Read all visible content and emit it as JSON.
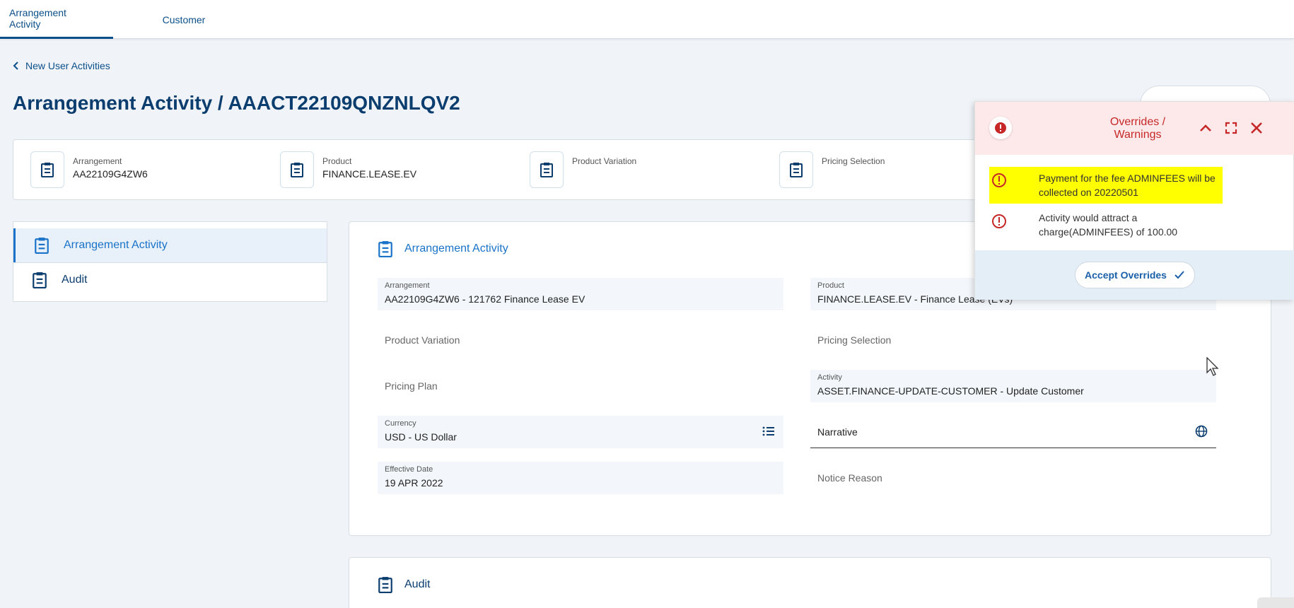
{
  "tabs": [
    {
      "label_line1": "Arrangement",
      "label_line2": "Activity"
    },
    {
      "label": "Customer"
    }
  ],
  "back_link": "New User Activities",
  "page_title": "Arrangement Activity / AAACT22109QNZNLQV2",
  "summary": [
    {
      "label": "Arrangement",
      "value": "AA22109G4ZW6"
    },
    {
      "label": "Product",
      "value": "FINANCE.LEASE.EV"
    },
    {
      "label": "Product Variation",
      "value": ""
    },
    {
      "label": "Pricing Selection",
      "value": ""
    }
  ],
  "nav": [
    {
      "label": "Arrangement Activity"
    },
    {
      "label": "Audit"
    }
  ],
  "section_title": "Arrangement Activity",
  "fields": {
    "arrangement": {
      "label": "Arrangement",
      "value": "AA22109G4ZW6 - 121762 Finance Lease EV"
    },
    "product": {
      "label": "Product",
      "value": "FINANCE.LEASE.EV - Finance Lease (EVs)"
    },
    "product_variation": {
      "placeholder": "Product Variation"
    },
    "pricing_selection": {
      "placeholder": "Pricing Selection"
    },
    "pricing_plan": {
      "placeholder": "Pricing Plan"
    },
    "activity": {
      "label": "Activity",
      "value": "ASSET.FINANCE-UPDATE-CUSTOMER - Update Customer"
    },
    "currency": {
      "label": "Currency",
      "value": "USD - US Dollar"
    },
    "narrative": {
      "placeholder": "Narrative"
    },
    "effective_date": {
      "label": "Effective Date",
      "value": "19 APR 2022"
    },
    "notice_reason": {
      "placeholder": "Notice Reason"
    }
  },
  "audit_title": "Audit",
  "overrides": {
    "title": "Overrides / Warnings",
    "messages": [
      "Payment for the fee ADMINFEES will be collected on 20220501",
      "Activity would attract a charge(ADMINFEES) of 100.00"
    ],
    "accept_label": "Accept Overrides"
  },
  "colors": {
    "primary": "#0b3d6e",
    "accent": "#1a73c8",
    "warning": "#c62828",
    "highlight": "#ffff00"
  }
}
